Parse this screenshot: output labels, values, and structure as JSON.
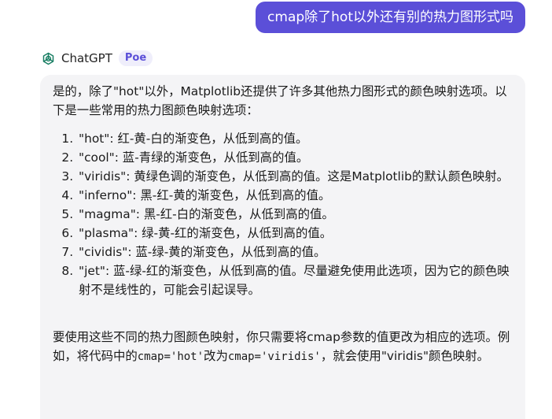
{
  "user_message": "cmap除了hot以外还有别的热力图形式吗",
  "bot": {
    "name": "ChatGPT",
    "badge": "Poe",
    "avatar_icon": "chatgpt-logo-icon"
  },
  "answer": {
    "intro": "是的，除了\"hot\"以外，Matplotlib还提供了许多其他热力图形式的颜色映射选项。以下是一些常用的热力图颜色映射选项：",
    "items": [
      "\"hot\": 红-黄-白的渐变色，从低到高的值。",
      "\"cool\": 蓝-青绿的渐变色，从低到高的值。",
      "\"viridis\": 黄绿色调的渐变色，从低到高的值。这是Matplotlib的默认颜色映射。",
      "\"inferno\": 黑-红-黄的渐变色，从低到高的值。",
      "\"magma\": 黑-红-白的渐变色，从低到高的值。",
      "\"plasma\": 绿-黄-红的渐变色，从低到高的值。",
      "\"cividis\": 蓝-绿-黄的渐变色，从低到高的值。",
      "\"jet\": 蓝-绿-红的渐变色，从低到高的值。尽量避免使用此选项，因为它的颜色映射不是线性的，可能会引起误导。"
    ],
    "outro_1": "要使用这些不同的热力图颜色映射，你只需要将cmap参数的值更改为相应的选项。例如，将代码中的",
    "code_hot": "cmap='hot'",
    "outro_2": "改为",
    "code_viridis": "cmap='viridis'",
    "outro_3": "，就会使用\"viridis\"颜色映射。"
  },
  "colors": {
    "accent": "#5b4fd8",
    "bubble_bg": "#f4f4f6",
    "badge_bg": "#efeefb"
  }
}
